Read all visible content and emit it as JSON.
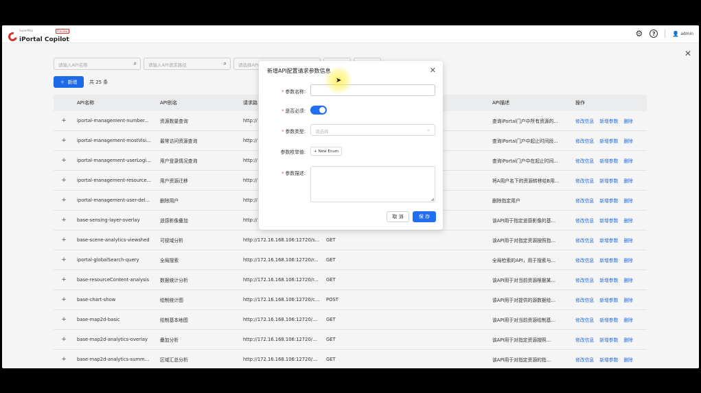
{
  "app": {
    "brand_small": "SuperMap",
    "brand_name": "iPortal Copilot",
    "brand_badge": "Preview",
    "user": "admin"
  },
  "filters": {
    "api_name_placeholder": "请输入API名称",
    "api_path_placeholder": "请输入API请求路径",
    "third_placeholder": "请选择API"
  },
  "toolbar": {
    "add_label": "新增",
    "total_label": "共 25 条"
  },
  "table": {
    "columns": [
      "API名称",
      "API别名",
      "请求路",
      "",
      "API描述",
      "操作"
    ],
    "rows": [
      {
        "name": "iportal-management-number...",
        "alias": "资源数量查询",
        "url": "http://",
        "method": "",
        "desc": "查询iPortal门户中所有资源的..."
      },
      {
        "name": "iportal-management-mostVisi...",
        "alias": "最常访问资源查询",
        "url": "http://",
        "method": "",
        "desc": "查询iPortal门户中起止时间段..."
      },
      {
        "name": "iportal-management-userLogi...",
        "alias": "用户登录情况查询",
        "url": "http://",
        "method": "",
        "desc": "查询iPortal门户中在起止时间..."
      },
      {
        "name": "iportal-management-resource...",
        "alias": "用户资源迁移",
        "url": "http://",
        "method": "",
        "desc": "将A用户名下的资源转移给B用..."
      },
      {
        "name": "iportal-management-user-del...",
        "alias": "删除用户",
        "url": "http://",
        "method": "",
        "desc": "删除指定用户"
      },
      {
        "name": "base-sensing-layer-overlay",
        "alias": "遥感影像叠加",
        "url": "http://",
        "method": "",
        "desc": "该API用于指定遥感影像的基..."
      },
      {
        "name": "base-scene-analytics-viewshed",
        "alias": "可视域分析",
        "url": "http://172.16.168.106:12720/s...",
        "method": "GET",
        "desc": "该API用于对指定资源按照指..."
      },
      {
        "name": "iportal-globalSearch-query",
        "alias": "全局搜索",
        "url": "http://172.16.168.106:12720/r...",
        "method": "GET",
        "desc": "全局检索的API，用于搜索与..."
      },
      {
        "name": "base-resourceContent-analysis",
        "alias": "数据统计分析",
        "url": "http://172.16.168.106:12720/r...",
        "method": "GET",
        "desc": "该API用于对当前资源根据某..."
      },
      {
        "name": "base-chart-show",
        "alias": "绘制统计图",
        "url": "http://172.16.168.106:12720/c...",
        "method": "POST",
        "desc": "该API用于对提供的源数据绘..."
      },
      {
        "name": "base-map2d-basic",
        "alias": "绘制基本地图",
        "url": "http://172.16.168.106:12720/...",
        "method": "GET",
        "desc": "该API用于对当前资源绘制基..."
      },
      {
        "name": "base-map2d-analytics-overlay",
        "alias": "叠加分析",
        "url": "http://172.16.168.106:12720/...",
        "method": "GET",
        "desc": "该API用于对指定资源按照..."
      },
      {
        "name": "base-map2d-analytics-summ...",
        "alias": "区域汇总分析",
        "url": "http://172.16.168.106:12720/...",
        "method": "GET",
        "desc": "该API用于对指定资源的指..."
      }
    ],
    "actions": {
      "edit": "修改信息",
      "add_param": "新增参数",
      "delete": "删除"
    },
    "expand_symbol": "+"
  },
  "modal": {
    "title": "新增API配置请求参数信息",
    "name_label": "参数名称:",
    "required_label": "是否必须:",
    "required_value": true,
    "type_label": "参数类型:",
    "type_placeholder": "请选择",
    "enum_label": "参数枚举值:",
    "enum_button": "New Enum",
    "desc_label": "参数描述:",
    "cancel_label": "取 消",
    "save_label": "保 存"
  }
}
